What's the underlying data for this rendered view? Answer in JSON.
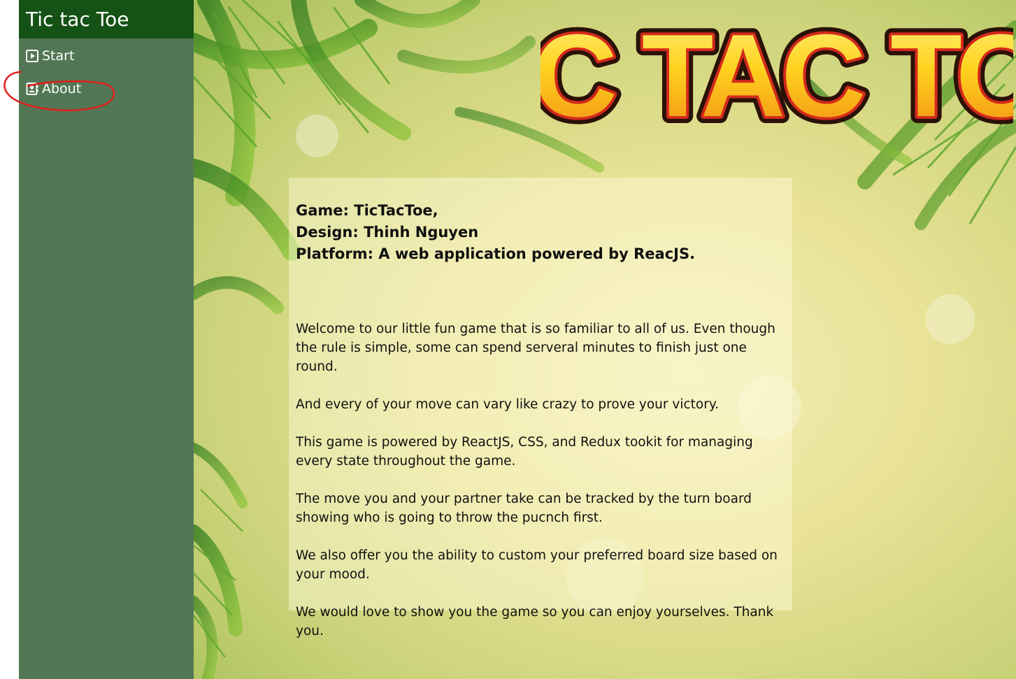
{
  "app": {
    "title": "Tic tac Toe"
  },
  "sidebar": {
    "items": [
      {
        "label": "Start",
        "icon": "play-square-icon"
      },
      {
        "label": "About",
        "icon": "contact-card-icon"
      }
    ]
  },
  "logo": {
    "text": "TIC TAC TOE"
  },
  "about": {
    "game": "Game: TicTacToe,",
    "design": "Design: Thinh Nguyen",
    "platform": "Platform: A web application powered by ReacJS.",
    "paragraphs": [
      "Welcome to our little fun game that is so familiar to all of us. Even though the rule is simple, some can spend serveral minutes to finish just one round.",
      "And every of your move can vary like crazy to prove your victory.",
      "This game is powered by ReactJS, CSS, and Redux tookit for managing every state throughout the game.",
      "The move you and your partner take can be tracked by the turn board showing who is going to throw the pucnch first.",
      "We also offer you the ability to custom your preferred board size based on your mood.",
      "We would love to show you the game so you can enjoy yourselves. Thank you."
    ]
  },
  "colors": {
    "sidebar_bg": "#527754",
    "sidebar_header_bg": "#145215",
    "annotation": "#e0201c",
    "logo_fill": "#ffd21f",
    "logo_outline": "#d42a1c"
  }
}
